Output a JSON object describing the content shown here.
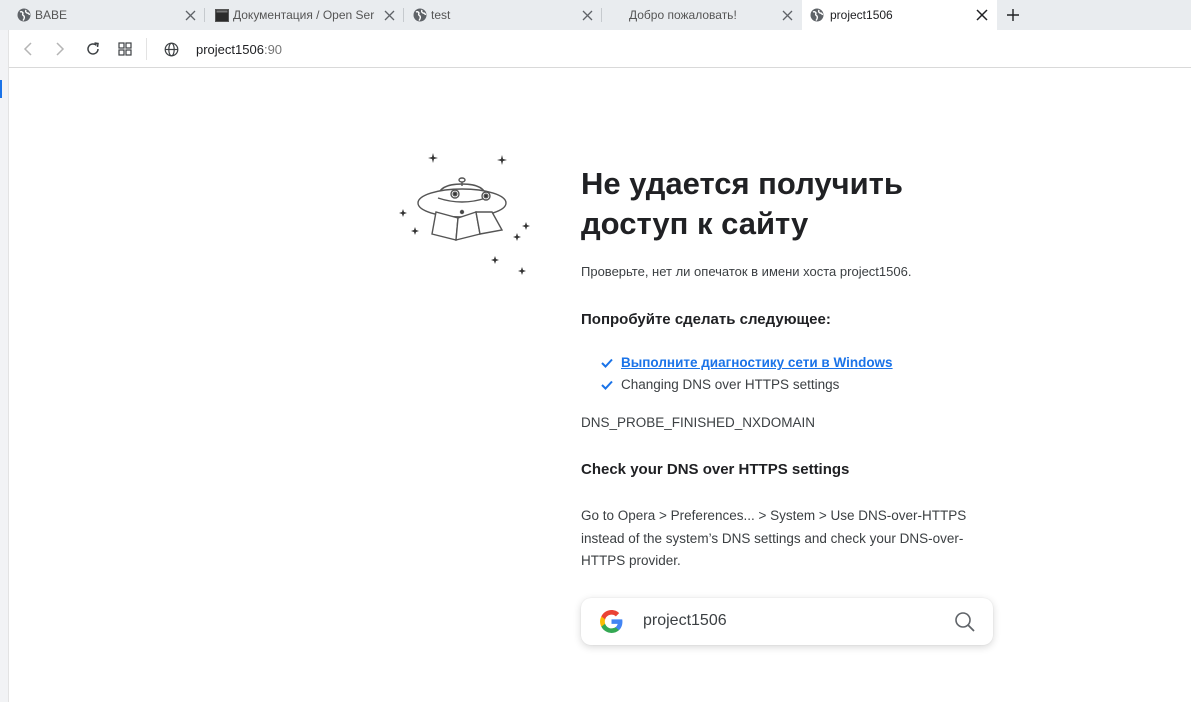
{
  "tabs": [
    {
      "title": "BABE",
      "favicon": "globe-icon",
      "active": false
    },
    {
      "title": "Документация / Open Ser",
      "favicon": "terminal-icon",
      "active": false
    },
    {
      "title": "test",
      "favicon": "globe-icon",
      "active": false
    },
    {
      "title": "Добро пожаловать!",
      "favicon": "none",
      "active": false
    },
    {
      "title": "project1506",
      "favicon": "globe-icon",
      "active": true
    }
  ],
  "address_bar": {
    "host": "project1506",
    "port": ":90"
  },
  "error_page": {
    "heading": "Не удается получить доступ к сайту",
    "check_text": "Проверьте, нет ли опечаток в имени хоста project1506.",
    "try_heading": "Попробуйте сделать следующее:",
    "suggestions": [
      {
        "text": "Выполните диагностику сети в Windows",
        "is_link": true
      },
      {
        "text": "Changing DNS over HTTPS settings",
        "is_link": false
      }
    ],
    "error_code": "DNS_PROBE_FINISHED_NXDOMAIN",
    "dns_heading": "Check your DNS over HTTPS settings",
    "dns_text": "Go to Opera > Preferences... > System > Use DNS-over-HTTPS instead of the system’s DNS settings and check your DNS-over-HTTPS provider."
  },
  "search_box": {
    "value": "project1506",
    "engine_icon": "google-logo-icon"
  },
  "colors": {
    "accent": "#1a73e8",
    "tabbar": "#e9ecef",
    "check": "#1a73e8"
  }
}
